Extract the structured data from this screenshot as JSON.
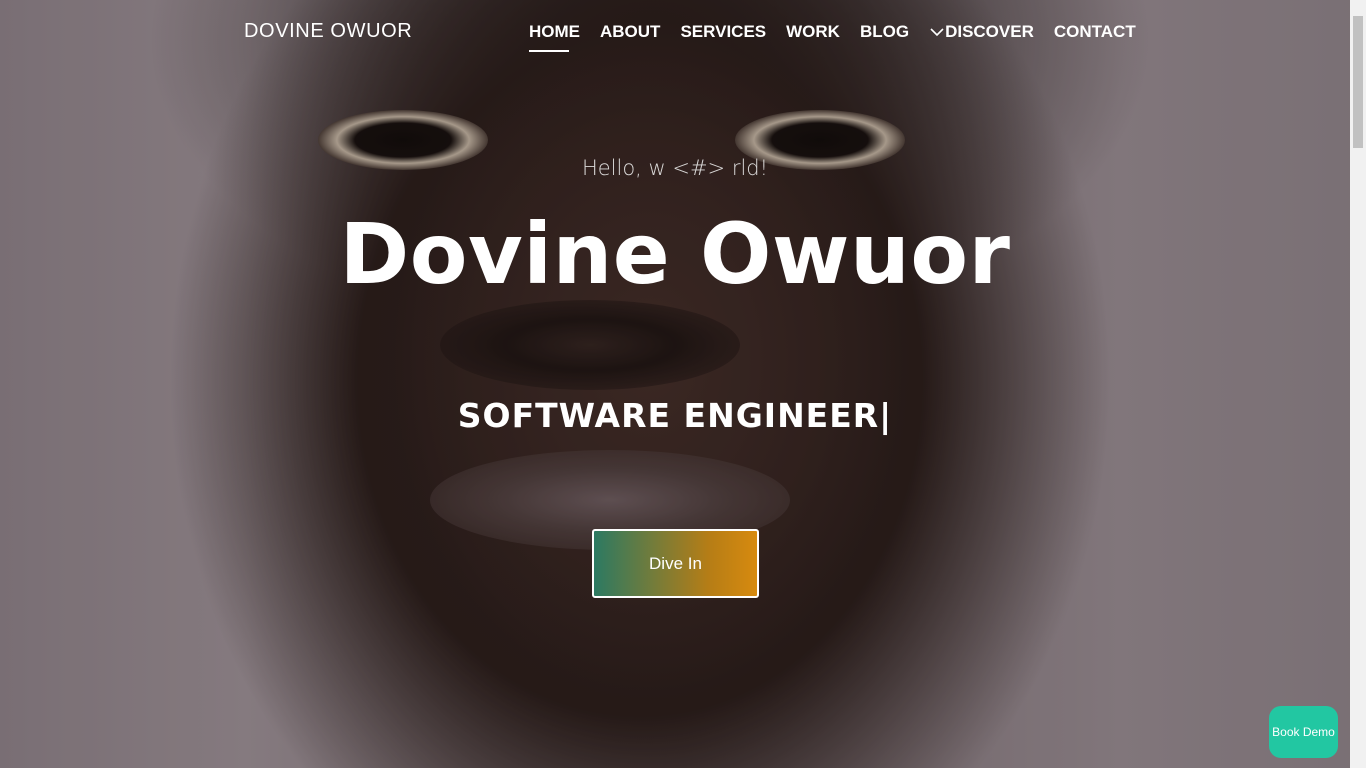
{
  "brand": "DOVINE OWUOR",
  "nav": {
    "items": [
      {
        "label": "HOME",
        "active": true
      },
      {
        "label": "ABOUT",
        "active": false
      },
      {
        "label": "SERVICES",
        "active": false
      },
      {
        "label": "WORK",
        "active": false
      },
      {
        "label": "BLOG",
        "active": false
      },
      {
        "label": "DISCOVER",
        "active": false,
        "icon": "chevron-down-icon"
      },
      {
        "label": "CONTACT",
        "active": false
      }
    ]
  },
  "hero": {
    "greeting": "Hello, w <#> rld!",
    "name": "Dovine Owuor",
    "role": "SOFTWARE ENGINEER|",
    "cta_label": "Dive In"
  },
  "floating": {
    "demo_label": "Book Demo"
  },
  "colors": {
    "cta_start": "#2c7a62",
    "cta_end": "#d78a0f",
    "demo_button": "#22c7a2"
  }
}
